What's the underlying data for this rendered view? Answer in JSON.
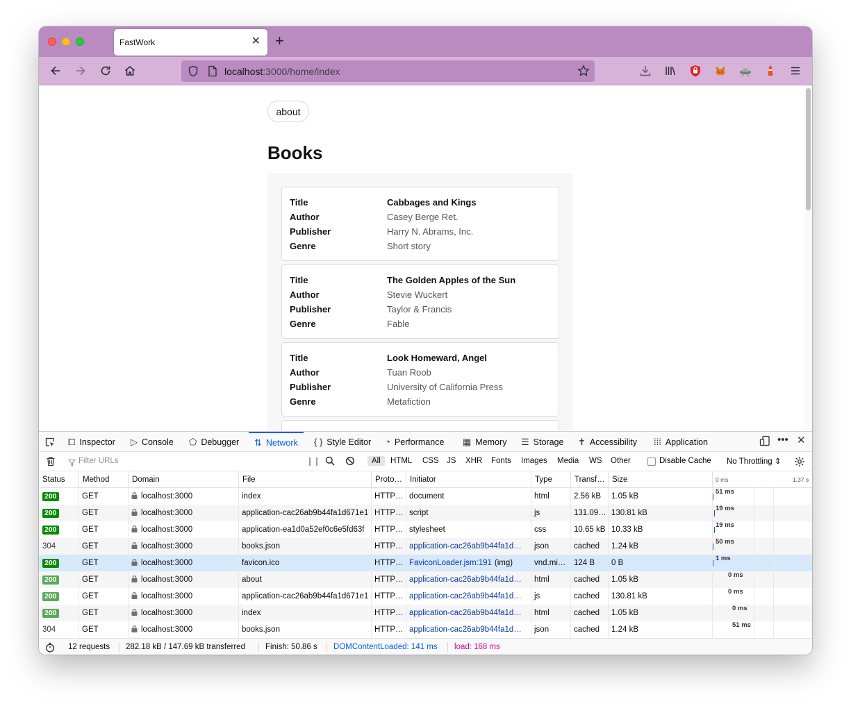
{
  "browser": {
    "tab_title": "FastWork",
    "tab_close": "✕",
    "new_tab": "+",
    "url_host": "localhost",
    "url_rest": ":3000/home/index"
  },
  "page": {
    "about_label": "about",
    "heading": "Books",
    "books": [
      {
        "title_label": "Title",
        "title": "Cabbages and Kings",
        "author_label": "Author",
        "author": "Casey Berge Ret.",
        "publisher_label": "Publisher",
        "publisher": "Harry N. Abrams, Inc.",
        "genre_label": "Genre",
        "genre": "Short story"
      },
      {
        "title_label": "Title",
        "title": "The Golden Apples of the Sun",
        "author_label": "Author",
        "author": "Stevie Wuckert",
        "publisher_label": "Publisher",
        "publisher": "Taylor & Francis",
        "genre_label": "Genre",
        "genre": "Fable"
      },
      {
        "title_label": "Title",
        "title": "Look Homeward, Angel",
        "author_label": "Author",
        "author": "Tuan Roob",
        "publisher_label": "Publisher",
        "publisher": "University of California Press",
        "genre_label": "Genre",
        "genre": "Metafiction"
      }
    ]
  },
  "devtools": {
    "tabs": [
      "Inspector",
      "Console",
      "Debugger",
      "Network",
      "Style Editor",
      "Performance",
      "Memory",
      "Storage",
      "Accessibility",
      "Application"
    ],
    "active_tab": "Network",
    "filter_placeholder": "Filter URLs",
    "filter_types": [
      "All",
      "HTML",
      "CSS",
      "JS",
      "XHR",
      "Fonts",
      "Images",
      "Media",
      "WS",
      "Other"
    ],
    "disable_cache": "Disable Cache",
    "throttling": "No Throttling ⇕",
    "columns": [
      "Status",
      "Method",
      "Domain",
      "File",
      "Proto…",
      "Initiator",
      "Type",
      "Transf…",
      "Size"
    ],
    "waterfall_ticks": [
      "0 ms",
      "1.37 s"
    ],
    "rows": [
      {
        "status": "200",
        "method": "GET",
        "domain": "localhost:3000",
        "file": "index",
        "proto": "HTTP…",
        "initiator": "document",
        "type": "html",
        "transferred": "2.56 kB",
        "size": "1.05 kB",
        "time": "51 ms"
      },
      {
        "status": "200",
        "method": "GET",
        "domain": "localhost:3000",
        "file": "application-cac26ab9b44fa1d671e1",
        "proto": "HTTP…",
        "initiator": "script",
        "type": "js",
        "transferred": "131.09…",
        "size": "130.81 kB",
        "time": "19 ms"
      },
      {
        "status": "200",
        "method": "GET",
        "domain": "localhost:3000",
        "file": "application-ea1d0a52ef0c6e5fd63f",
        "proto": "HTTP…",
        "initiator": "stylesheet",
        "type": "css",
        "transferred": "10.65 kB",
        "size": "10.33 kB",
        "time": "19 ms"
      },
      {
        "status": "304",
        "method": "GET",
        "domain": "localhost:3000",
        "file": "books.json",
        "proto": "HTTP…",
        "initiator": "application-cac26ab9b44fa1d…",
        "type": "json",
        "transferred": "cached",
        "size": "1.24 kB",
        "time": "50 ms"
      },
      {
        "status": "200",
        "method": "GET",
        "domain": "localhost:3000",
        "file": "favicon.ico",
        "proto": "HTTP…",
        "initiator": "FaviconLoader.jsm:191",
        "initiator_suffix": "(img)",
        "type": "vnd.mi…",
        "transferred": "124 B",
        "size": "0 B",
        "time": "1 ms"
      },
      {
        "status": "200",
        "method": "GET",
        "domain": "localhost:3000",
        "file": "about",
        "proto": "HTTP…",
        "initiator": "application-cac26ab9b44fa1d…",
        "type": "html",
        "transferred": "cached",
        "size": "1.05 kB",
        "time": "0 ms"
      },
      {
        "status": "200",
        "method": "GET",
        "domain": "localhost:3000",
        "file": "application-cac26ab9b44fa1d671e1",
        "proto": "HTTP…",
        "initiator": "application-cac26ab9b44fa1d…",
        "type": "js",
        "transferred": "cached",
        "size": "130.81 kB",
        "time": "0 ms"
      },
      {
        "status": "200",
        "method": "GET",
        "domain": "localhost:3000",
        "file": "index",
        "proto": "HTTP…",
        "initiator": "application-cac26ab9b44fa1d…",
        "type": "html",
        "transferred": "cached",
        "size": "1.05 kB",
        "time": "0 ms"
      },
      {
        "status": "304",
        "method": "GET",
        "domain": "localhost:3000",
        "file": "books.json",
        "proto": "HTTP…",
        "initiator": "application-cac26ab9b44fa1d…",
        "type": "json",
        "transferred": "cached",
        "size": "1.24 kB",
        "time": "51 ms"
      }
    ],
    "summary": {
      "requests": "12 requests",
      "transferred": "282.18 kB / 147.69 kB transferred",
      "finish": "Finish: 50.86 s",
      "dom_loaded": "DOMContentLoaded: 141 ms",
      "load": "load: 168 ms"
    }
  }
}
